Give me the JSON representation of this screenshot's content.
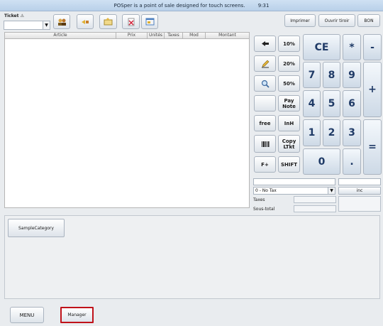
{
  "title": "POSper is a point of sale designed for touch screens.",
  "time": "9:31",
  "ticket_label": "Ticket",
  "ticket_icon": "⚠",
  "toolbar_right": {
    "print": "Imprimer",
    "open_drawer": "Ouvrir tiroir",
    "bon": "BON"
  },
  "table": {
    "columns": [
      "Article",
      "Prix",
      "Unités",
      "Taxes",
      "Mod",
      "Montant"
    ]
  },
  "action_buttons": {
    "pct10": "10%",
    "pct20": "20%",
    "pct50": "50%",
    "pay_note_1": "Pay",
    "pay_note_2": "Note",
    "free": "free",
    "inh": "InH",
    "copy_1": "Copy",
    "copy_2": "LTkt",
    "fplus": "F+",
    "shift": "SHIFT"
  },
  "keypad": {
    "ce": "CE",
    "multiply": "*",
    "minus": "-",
    "seven": "7",
    "eight": "8",
    "nine": "9",
    "plus": "+",
    "four": "4",
    "five": "5",
    "six": "6",
    "one": "1",
    "two": "2",
    "three": "3",
    "equals": "=",
    "zero": "0",
    "dot": "."
  },
  "tax_select": "0 - No Tax",
  "inc_label": "inc",
  "taxes_label": "Taxes",
  "subtotal_label": "Sous-total",
  "category": "SampleCategory",
  "bottom": {
    "menu": "MENU",
    "manager": "Manager"
  },
  "colors": {
    "keypad_text": "#1f3a66",
    "manager_border": "#c0121a"
  }
}
